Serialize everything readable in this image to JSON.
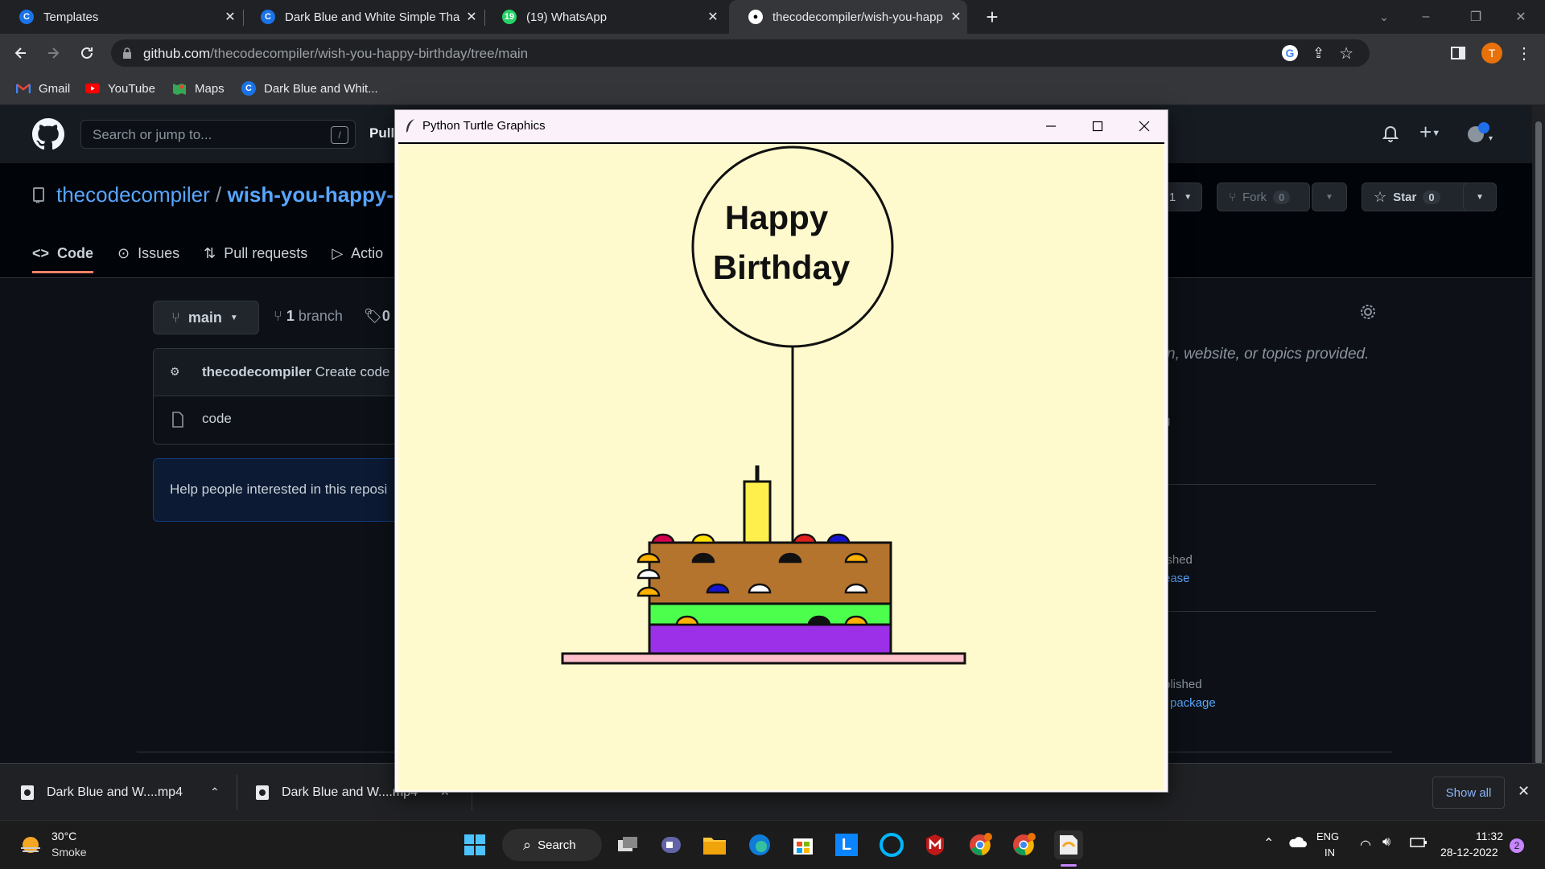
{
  "browser": {
    "tabs": [
      {
        "title": "Templates",
        "icon": "canva-icon"
      },
      {
        "title": "Dark Blue and White Simple Thar",
        "icon": "canva-icon"
      },
      {
        "title": "(19) WhatsApp",
        "icon": "whatsapp-icon"
      },
      {
        "title": "thecodecompiler/wish-you-happ",
        "icon": "github-icon"
      }
    ],
    "url_domain": "github.com",
    "url_path": "/thecodecompiler/wish-you-happy-birthday/tree/main",
    "profile_initial": "T",
    "bookmarks": [
      "Gmail",
      "YouTube",
      "Maps",
      "Dark Blue and Whit..."
    ]
  },
  "github": {
    "search_placeholder": "Search or jump to...",
    "search_shortcut": "/",
    "header_pull": "Pull",
    "owner": "thecodecompiler",
    "separator": "/",
    "repo_name": "wish-you-happy-bi",
    "nav_tabs": [
      "Code",
      "Issues",
      "Pull requests",
      "Actio"
    ],
    "watch_count": "1",
    "fork_label": "Fork",
    "fork_count": "0",
    "star_label": "Star",
    "star_count": "0",
    "branch_name": "main",
    "branches_count": "1",
    "branches_label": "branch",
    "tags_count": "0",
    "commit_author": "thecodecompiler",
    "commit_message": "Create code",
    "file_name": "code",
    "help_text": "Help people interested in this reposi",
    "about_fragment": "n, website, or topics provided.",
    "side_g": "g",
    "published_1": "ished",
    "release_1": "ease",
    "published_2": "blished",
    "package_text": "package"
  },
  "turtle_window": {
    "title": "Python Turtle Graphics",
    "balloon_line1": "Happy",
    "balloon_line2": "Birthday",
    "colors": {
      "background": "#fffacd",
      "cake_top": "#b5742e",
      "cake_mid": "#4dff4d",
      "cake_bottom": "#9b30e8",
      "plate": "#ffc0cb",
      "candle": "#ffef4d"
    }
  },
  "downloads": {
    "items": [
      "Dark Blue and W....mp4",
      "Dark Blue and W....mp4"
    ],
    "show_all": "Show all"
  },
  "taskbar": {
    "weather_temp": "30°C",
    "weather_desc": "Smoke",
    "search_label": "Search",
    "lang1": "ENG",
    "lang2": "IN",
    "time": "11:32",
    "date": "28-12-2022",
    "notif_count": "2"
  }
}
